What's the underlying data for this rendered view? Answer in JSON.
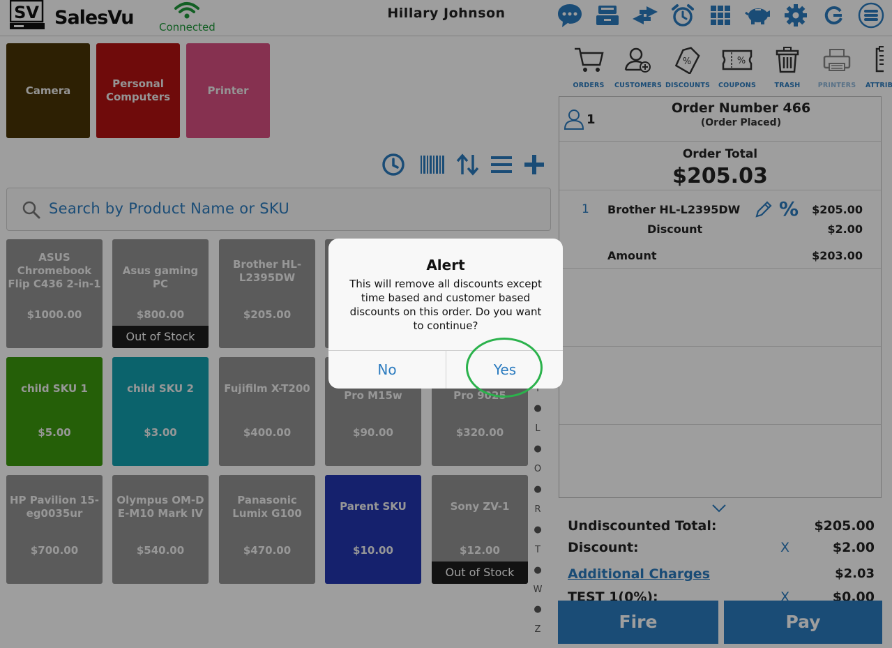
{
  "header": {
    "app_name": "SalesVu",
    "logo_text": "SV",
    "connection_status": "Connected",
    "user_name": "Hillary  Johnson",
    "icons": [
      "chat-icon",
      "cash-drawer-icon",
      "transfer-icon",
      "alarm-icon",
      "grid-icon",
      "piggy-bank-icon",
      "gear-icon",
      "refresh-icon",
      "menu-icon"
    ]
  },
  "categories": [
    {
      "label": "Camera",
      "color": "#4a3506"
    },
    {
      "label": "Personal Computers",
      "color": "#b31212"
    },
    {
      "label": "Printer",
      "color": "#d84f82"
    }
  ],
  "toolbar": {
    "icons": [
      "history-icon",
      "barcode-icon",
      "sort-icon",
      "list-icon",
      "add-icon"
    ]
  },
  "search": {
    "placeholder": "Search by Product Name or SKU"
  },
  "products": [
    {
      "name": "ASUS Chromebook Flip C436 2-in-1",
      "price": "$1000.00",
      "status": ""
    },
    {
      "name": "Asus gaming PC",
      "price": "$800.00",
      "status": "Out of Stock"
    },
    {
      "name": "Brother HL-L2395DW",
      "price": "$205.00",
      "status": ""
    },
    {
      "name": "child SKU 1",
      "price": "$5.00",
      "status": "",
      "color": "#3c9a0e"
    },
    {
      "name": "child SKU 2",
      "price": "$3.00",
      "status": "",
      "color": "#13a1ae"
    },
    {
      "name": "Fujifilm X-T200",
      "price": "$400.00",
      "status": ""
    },
    {
      "name": "Pro M15w",
      "price": "$90.00",
      "status": ""
    },
    {
      "name": "Pro 9025",
      "price": "$320.00",
      "status": ""
    },
    {
      "name": "HP Pavilion 15-eg0035ur",
      "price": "$700.00",
      "status": ""
    },
    {
      "name": "Olympus OM-D E-M10 Mark IV",
      "price": "$540.00",
      "status": ""
    },
    {
      "name": "Panasonic Lumix G100",
      "price": "$470.00",
      "status": ""
    },
    {
      "name": "Parent SKU",
      "price": "$10.00",
      "status": "",
      "color": "#2336b0"
    },
    {
      "name": "Sony ZV-1",
      "price": "$12.00",
      "status": "Out of Stock"
    }
  ],
  "alphabet_index": [
    "I",
    "L",
    "O",
    "R",
    "T",
    "W",
    "Z"
  ],
  "order_tools": [
    {
      "label": "ORDERS",
      "icon": "cart-icon"
    },
    {
      "label": "CUSTOMERS",
      "icon": "add-customer-icon"
    },
    {
      "label": "DISCOUNTS",
      "icon": "discount-tag-icon"
    },
    {
      "label": "COUPONS",
      "icon": "coupon-icon"
    },
    {
      "label": "TRASH",
      "icon": "trash-icon"
    },
    {
      "label": "PRINTERS",
      "icon": "printer-icon"
    },
    {
      "label": "ATTRIB",
      "icon": "clipboard-icon"
    }
  ],
  "order": {
    "guest_count": "1",
    "number_label": "Order Number 466",
    "status_label": "(Order Placed)",
    "total_label": "Order Total",
    "total_value": "$205.03",
    "line_item": {
      "qty": "1",
      "name": "Brother HL-L2395DW",
      "price": "$205.00",
      "discount_label": "Discount",
      "discount_value": "$2.00",
      "amount_label": "Amount",
      "amount_value": "$203.00"
    }
  },
  "totals": {
    "undiscounted_label": "Undiscounted Total:",
    "undiscounted_value": "$205.00",
    "discount_label": "Discount:",
    "discount_remove": "X",
    "discount_value": "$2.00",
    "additional_label": "Additional Charges",
    "additional_value": "$2.03",
    "tax_label": "TEST 1(0%):",
    "tax_remove": "X",
    "tax_value": "$0.00"
  },
  "actions": {
    "fire_label": "Fire",
    "pay_label": "Pay"
  },
  "alert": {
    "title": "Alert",
    "message": "This will remove all discounts except time based and customer based discounts on this order. Do you want to continue?",
    "no_label": "No",
    "yes_label": "Yes"
  },
  "colors": {
    "accent": "#2b7bbf",
    "connected": "#1f9a3a",
    "highlight": "#2bb24c"
  }
}
